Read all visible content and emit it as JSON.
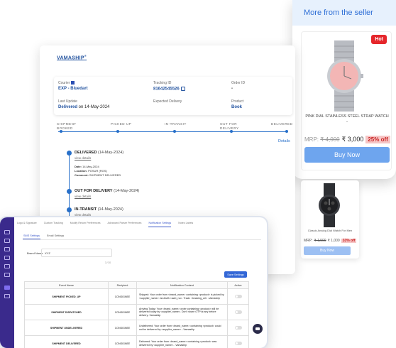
{
  "seller": {
    "header": "More from the seller",
    "product1": {
      "badge": "Hot",
      "name": "PINK DIAL STAINLESS STEEL STRAP WATCH",
      "dash": "-",
      "mrp_label": "MRP: ",
      "mrp_old": "₹ 4,000",
      "price": "₹ 3,000",
      "discount": "25% off",
      "buy_label": "Buy Now"
    },
    "product2": {
      "name": "Classic Analog Dial Watch For Men",
      "mrp_label": "MRP: ",
      "mrp_old": "₹ 1,500",
      "price": "₹ 1,000",
      "discount": "33% off",
      "buy_label": "Buy Now"
    }
  },
  "tracking": {
    "logo": "VAMASHIP",
    "courier_label": "Courier",
    "courier_value": "EXP - Bluedart",
    "tracking_label": "Tracking ID",
    "tracking_value": "81642545526",
    "order_label": "Order ID",
    "order_value": "-",
    "last_update_label": "Last Update",
    "last_update_status": "Delivered",
    "last_update_date": " on 14-May-2024",
    "expected_label": "Expected Delivery",
    "product_label": "Product",
    "product_value": "Book",
    "steps": [
      {
        "line1": "SHIPMENT",
        "line2": "BOOKED"
      },
      {
        "line1": "PICKED UP",
        "line2": ""
      },
      {
        "line1": "IN-TRANSIT",
        "line2": ""
      },
      {
        "line1": "OUT FOR",
        "line2": "DELIVERY"
      },
      {
        "line1": "DELIVERED",
        "line2": ""
      }
    ],
    "details_link": "Details",
    "timeline": [
      {
        "status": "DELIVERED",
        "date": " (14-May-2024)",
        "sub": "view details",
        "meta_date_label": "Date: ",
        "meta_date": "14-May-2024",
        "meta_loc_label": "Location: ",
        "meta_loc": "POSUR (RGS)",
        "meta_comment_label": "Comment: ",
        "meta_comment": "SHIPMENT DELIVERED"
      },
      {
        "status": "OUT FOR DELIVERY",
        "date": " (14-May-2024)",
        "sub": "view details"
      },
      {
        "status": "IN-TRANSIT",
        "date": " (14-May-2024)",
        "sub": "view details"
      }
    ]
  },
  "settings": {
    "top_tabs": [
      "Logo & Signature",
      "Custom Tracking",
      "Modify Return Preferences",
      "Advanced Parser Preferences",
      "Notification Settings",
      "Notes Labels"
    ],
    "sub_tabs": [
      "SMS Settings",
      "Email Settings"
    ],
    "brand_label": "Brand Name",
    "brand_value": "XYZ",
    "char_count": "3 / 30",
    "save_label": "Save Settings",
    "columns": [
      "Event Name",
      "Recipient",
      "Notification Content",
      "Active"
    ],
    "rows": [
      {
        "event": "SHIPMENT PICKED_UP",
        "recipient": "CONSIGNEE",
        "content": "Shipped: Your order from <brand_name> containing <product> is picked by <supplier_name> via #with <awb_no>. Track: <tracking_url> -Vamaship"
      },
      {
        "event": "SHIPMENT DISPATCHED",
        "recipient": "CONSIGNEE",
        "content": "Arriving Today: Your <brand_name> order containing <product> will be delivered today by <supplier_name>. Don't share OTP at any before delivery -Vamaship"
      },
      {
        "event": "SHIPMENT UNDELIVERED",
        "recipient": "CONSIGNEE",
        "content": "Undelivered: Your order from <brand_name> containing <product> could not be delivered by <supplier_name>. -Vamaship"
      },
      {
        "event": "SHIPMENT DELIVERED",
        "recipient": "CONSIGNEE",
        "content": "Delivered: Your order from <brand_name> containing <product> was delivered by <supplier_name>. -Vamaship"
      }
    ]
  },
  "colors": {
    "accent_blue": "#2870c9",
    "hot_red": "#e5262b",
    "buy_blue": "#6ea5ee",
    "rail_purple": "#3a2a8c"
  }
}
